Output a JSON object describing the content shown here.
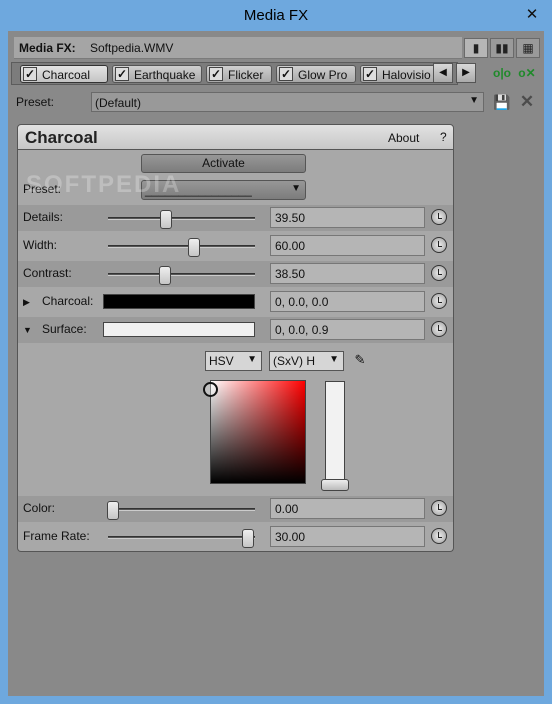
{
  "window": {
    "title": "Media FX",
    "close": "✕"
  },
  "header": {
    "label": "Media FX:",
    "file": "Softpedia.WMV"
  },
  "view_buttons": [
    "view-single-icon",
    "view-double-icon",
    "view-grid-icon"
  ],
  "tabs": [
    {
      "label": "Charcoal",
      "checked": true,
      "active": true
    },
    {
      "label": "Earthquake",
      "checked": true,
      "active": false
    },
    {
      "label": "Flicker",
      "checked": true,
      "active": false
    },
    {
      "label": "Glow Pro",
      "checked": true,
      "active": false
    },
    {
      "label": "Halovisio",
      "checked": true,
      "active": false
    }
  ],
  "tab_nav": {
    "prev": "◀",
    "next": "▶"
  },
  "preset_bar": {
    "label": "Preset:",
    "value": "(Default)"
  },
  "panel": {
    "title": "Charcoal",
    "about": "About",
    "help": "?",
    "activate": "Activate",
    "preset_label": "Preset:",
    "preset_value": "________________",
    "params": [
      {
        "label": "Details:",
        "value": "39.50",
        "level": 0.395
      },
      {
        "label": "Width:",
        "value": "60.00",
        "level": 0.6
      },
      {
        "label": "Contrast:",
        "value": "38.50",
        "level": 0.385
      }
    ],
    "charcoal": {
      "label": "Charcoal:",
      "value": "0, 0.0, 0.0",
      "color": "#000000"
    },
    "surface": {
      "label": "Surface:",
      "value": "0, 0.0, 0.9",
      "color": "#f0f0f0"
    },
    "color_model": "HSV",
    "color_mode": "(SxV) H",
    "color_row": {
      "label": "Color:",
      "value": "0.00",
      "level": 0.0
    },
    "frame_rate": {
      "label": "Frame Rate:",
      "value": "30.00",
      "level": 1.0
    }
  },
  "watermark": "SOFTPEDIA"
}
